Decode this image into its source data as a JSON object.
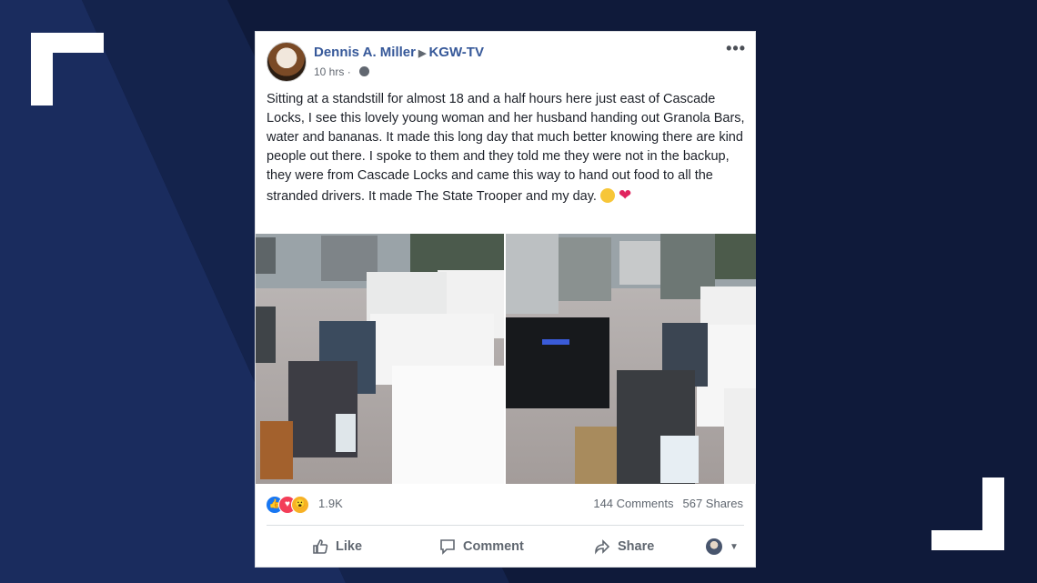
{
  "post": {
    "author": "Dennis A. Miller",
    "page": "KGW-TV",
    "time": "10 hrs",
    "text": "Sitting at a standstill for almost 18 and a half hours here just east of Cascade Locks, I see this lovely young woman and her husband handing out Granola Bars, water and bananas. It made this long day that much better knowing there are kind people out there. I spoke to them and they told me they were not in the backup, they were from Cascade Locks and came this way to hand out food to all the stranded drivers. It made The State Trooper and my day.",
    "reactions_count": "1.9K",
    "comments": "144 Comments",
    "shares": "567 Shares"
  },
  "actions": {
    "like": "Like",
    "comment": "Comment",
    "share": "Share"
  },
  "icons": {
    "more": "more-options-icon",
    "privacy": "globe-icon",
    "reactions": [
      "like-reaction-icon",
      "love-reaction-icon",
      "wow-reaction-icon"
    ],
    "audience": "audience-selector-icon"
  },
  "colors": {
    "author": "#365899",
    "background": "#0f1a3a"
  }
}
